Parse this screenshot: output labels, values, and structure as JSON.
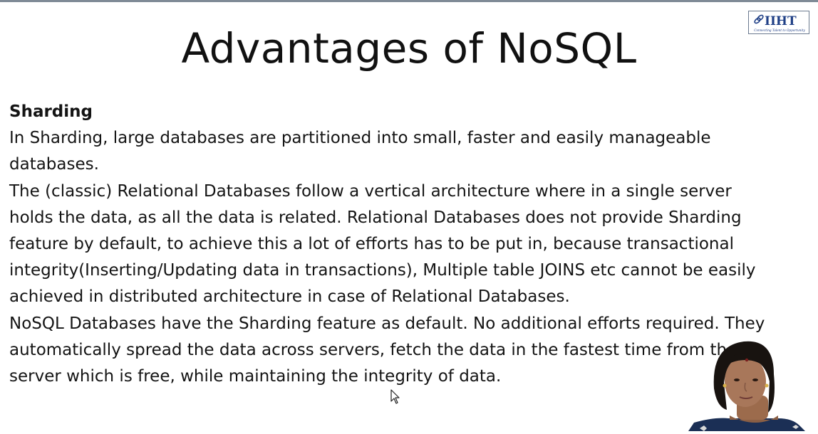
{
  "slide": {
    "title": "Advantages of NoSQL",
    "logo_text": "IIHT",
    "logo_tagline": "Connecting Talent to Opportunity",
    "section_heading": "Sharding",
    "paragraphs": [
      "In Sharding, large databases are partitioned into small, faster and easily manageable databases.",
      "The (classic) Relational Databases follow a vertical architecture where in a single server holds the data, as all the data is related. Relational Databases does not provide Sharding feature by default, to achieve this a lot of efforts has to be put in, because transactional integrity(Inserting/Updating data in transactions), Multiple table JOINS etc cannot be easily achieved in distributed architecture in case of Relational Databases.",
      "NoSQL Databases have the Sharding feature as default. No additional efforts required. They automatically spread the data across servers, fetch the data in the fastest time from the server which is free, while maintaining the integrity of data."
    ]
  },
  "colors": {
    "text": "#141414",
    "logo_blue": "#1f3f86",
    "rule": "#7f8a96"
  }
}
